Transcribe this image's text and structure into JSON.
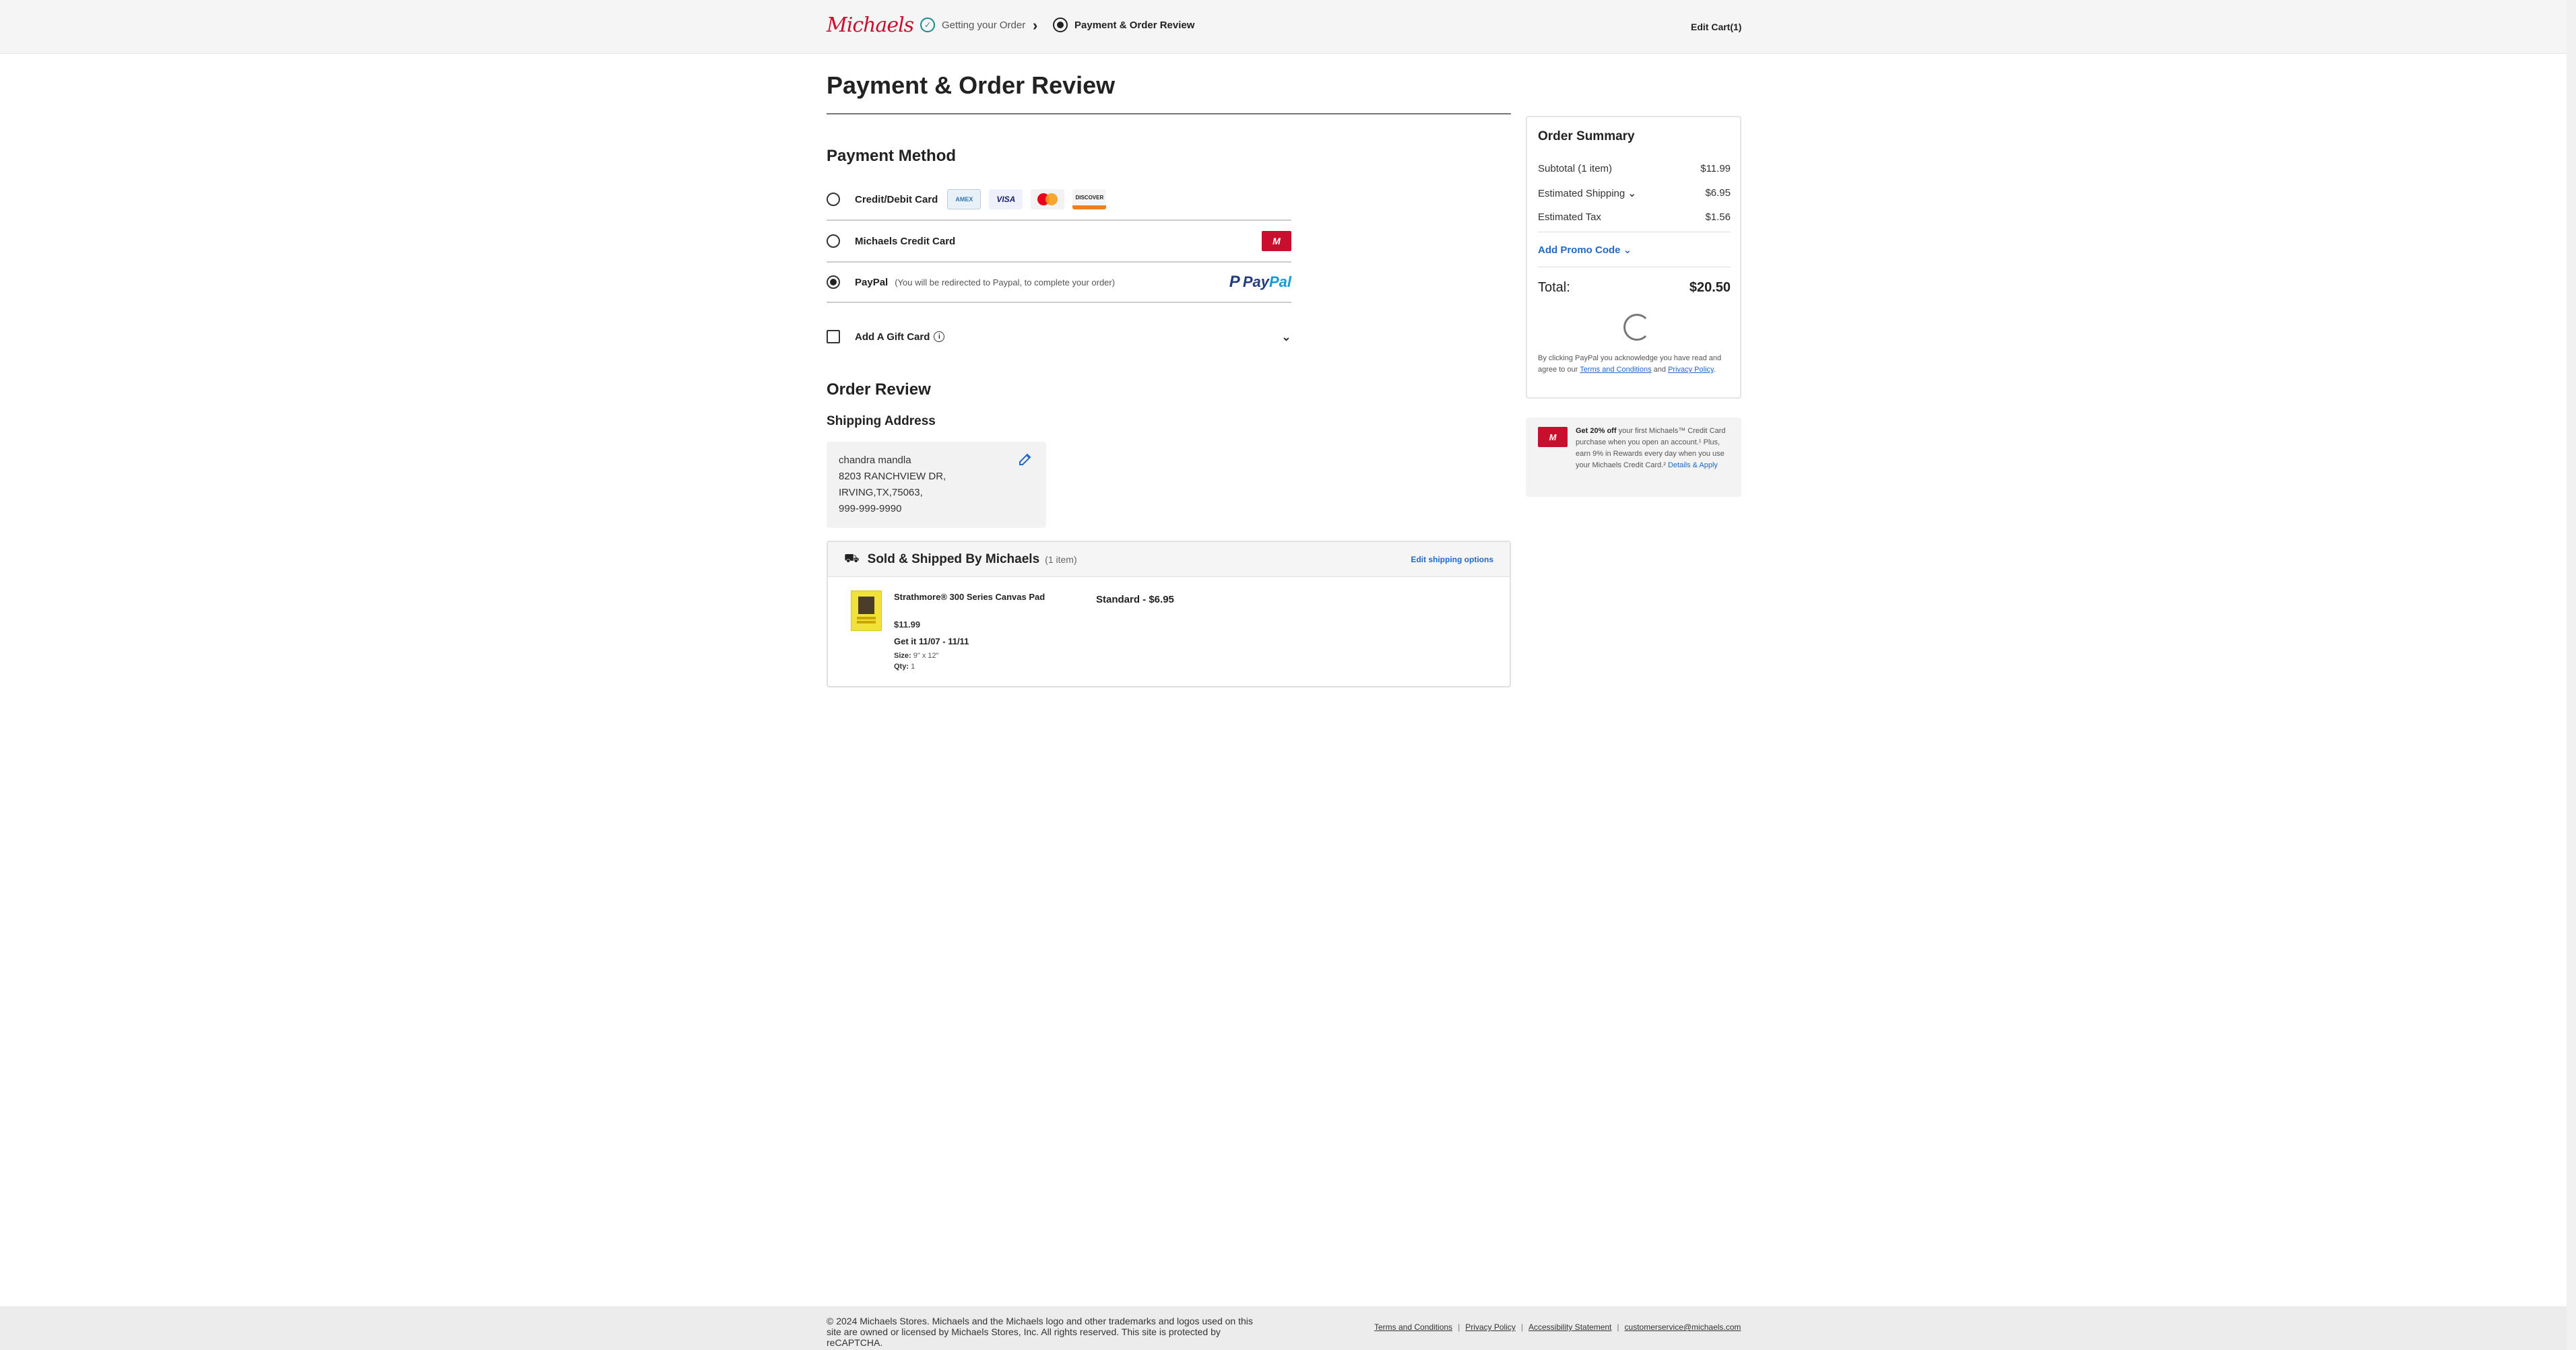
{
  "header": {
    "logo_text": "Michaels",
    "step1_label": "Getting your Order",
    "step2_label": "Payment & Order Review",
    "edit_cart": "Edit Cart(1)"
  },
  "page_title": "Payment & Order Review",
  "payment_method": {
    "title": "Payment Method",
    "options": [
      {
        "label": "Credit/Debit Card",
        "selected": false,
        "cards": [
          "AMERICAN EXPRESS",
          "VISA",
          "mastercard",
          "DISCOVER"
        ]
      },
      {
        "label": "Michaels Credit Card",
        "selected": false
      },
      {
        "label": "PayPal",
        "note": "(You will be redirected to Paypal, to complete your order)",
        "selected": true,
        "logo_a": "Pay",
        "logo_b": "Pal"
      }
    ],
    "gift_card_label": "Add A Gift Card"
  },
  "order_review": {
    "title": "Order Review",
    "shipping_address_title": "Shipping Address",
    "address": {
      "name": "chandra mandla",
      "line1": "8203 RANCHVIEW DR,",
      "line2": "IRVING,TX,75063,",
      "phone": "999-999-9990"
    },
    "shipment": {
      "title": "Sold & Shipped By Michaels",
      "count": "(1 item)",
      "edit_link": "Edit shipping options",
      "product_name": "Strathmore® 300 Series Canvas Pad",
      "price": "$11.99",
      "eta": "Get it 11/07 - 11/11",
      "size_label": "Size:",
      "size_value": "9\" x 12\"",
      "qty_label": "Qty:",
      "qty_value": "1",
      "method": "Standard - $6.95"
    }
  },
  "summary": {
    "title": "Order Summary",
    "subtotal_label": "Subtotal (1 item)",
    "subtotal_value": "$11.99",
    "shipping_label": "Estimated Shipping",
    "shipping_value": "$6.95",
    "tax_label": "Estimated Tax",
    "tax_value": "$1.56",
    "promo_label": "Add Promo Code",
    "total_label": "Total:",
    "total_value": "$20.50",
    "note_prefix": "By clicking PayPal you acknowledge you have read and agree to our",
    "terms_link": "Terms and Conditions",
    "note_and": "and",
    "privacy_link": "Privacy Policy",
    "note_end": "."
  },
  "promo_card": {
    "bold": "Get 20% off",
    "text": "your first Michaels™ Credit Card purchase when you open an account.¹ Plus, earn 9% in Rewards every day when you use your Michaels Credit Card.²",
    "link": "Details & Apply"
  },
  "footer": {
    "copyright": "© 2024 Michaels Stores. Michaels and the Michaels logo and other trademarks and logos used on this site are owned or licensed by Michaels Stores, Inc. All rights reserved. This site is protected by reCAPTCHA.",
    "links": [
      "Terms and Conditions",
      "Privacy Policy",
      "Accessibility Statement",
      "customerservice@michaels.com"
    ]
  }
}
